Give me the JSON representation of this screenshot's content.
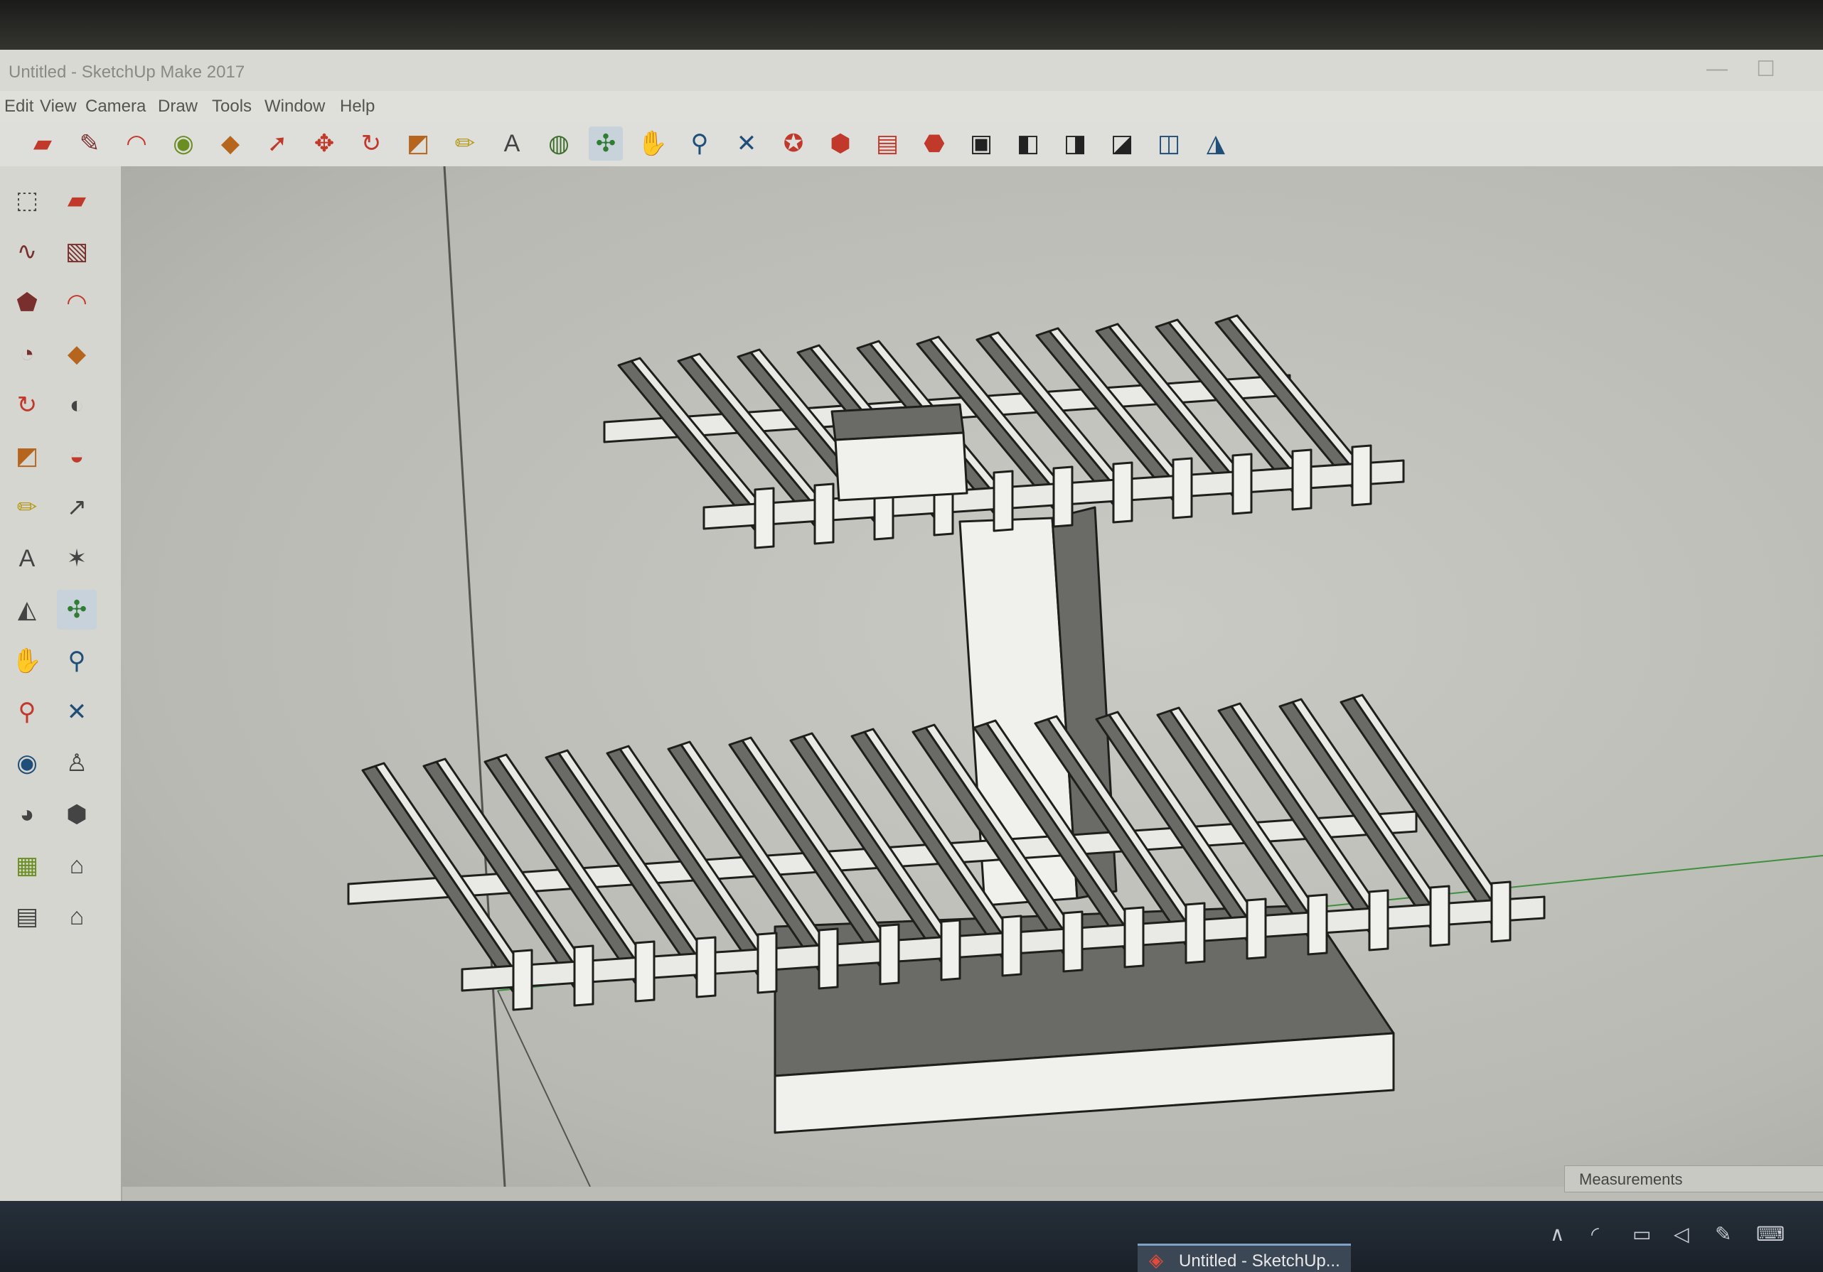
{
  "window": {
    "title": "Untitled - SketchUp Make 2017",
    "controls": {
      "minimize": "—",
      "maximize": "☐"
    }
  },
  "menu": [
    {
      "label": "Edit"
    },
    {
      "label": "View"
    },
    {
      "label": "Camera"
    },
    {
      "label": "Draw"
    },
    {
      "label": "Tools"
    },
    {
      "label": "Window"
    },
    {
      "label": "Help"
    }
  ],
  "toolbar": [
    {
      "icon": "eraser-icon",
      "glyph": "▰",
      "color": "#c0392b"
    },
    {
      "icon": "pencil-icon",
      "glyph": "✎",
      "color": "#7a2f2f"
    },
    {
      "icon": "arc-icon",
      "glyph": "◠",
      "color": "#c0392b"
    },
    {
      "icon": "circle-icon",
      "glyph": "◉",
      "color": "#6b8e23"
    },
    {
      "icon": "push-pull-icon",
      "glyph": "◆",
      "color": "#b5651d"
    },
    {
      "icon": "follow-me-icon",
      "glyph": "➚",
      "color": "#c0392b"
    },
    {
      "icon": "move-icon",
      "glyph": "✥",
      "color": "#c0392b"
    },
    {
      "icon": "rotate-icon",
      "glyph": "↻",
      "color": "#c0392b"
    },
    {
      "icon": "scale-icon",
      "glyph": "◩",
      "color": "#b5651d"
    },
    {
      "icon": "tape-measure-icon",
      "glyph": "✏",
      "color": "#b59b1d"
    },
    {
      "icon": "text-icon",
      "glyph": "A",
      "color": "#444444"
    },
    {
      "icon": "paint-bucket-icon",
      "glyph": "◍",
      "color": "#3b6e2a"
    },
    {
      "icon": "orbit-icon",
      "glyph": "✣",
      "color": "#2e7d32",
      "active": true
    },
    {
      "icon": "pan-icon",
      "glyph": "✋",
      "color": "#b59b1d"
    },
    {
      "icon": "zoom-icon",
      "glyph": "⚲",
      "color": "#1f4e79"
    },
    {
      "icon": "zoom-extents-icon",
      "glyph": "✕",
      "color": "#1f4e79"
    },
    {
      "icon": "warehouse-icon",
      "glyph": "✪",
      "color": "#c0392b"
    },
    {
      "icon": "share-model-icon",
      "glyph": "⬢",
      "color": "#c0392b"
    },
    {
      "icon": "extension-warehouse-icon",
      "glyph": "▤",
      "color": "#c0392b"
    },
    {
      "icon": "layout-icon",
      "glyph": "⬣",
      "color": "#c0392b"
    },
    {
      "icon": "iso-view-icon",
      "glyph": "▣",
      "color": "#222222"
    },
    {
      "icon": "top-view-icon",
      "glyph": "◧",
      "color": "#222222"
    },
    {
      "icon": "front-view-icon",
      "glyph": "◨",
      "color": "#222222"
    },
    {
      "icon": "right-view-icon",
      "glyph": "◪",
      "color": "#222222"
    },
    {
      "icon": "back-view-icon",
      "glyph": "◫",
      "color": "#1f4e79"
    },
    {
      "icon": "left-view-icon",
      "glyph": "◮",
      "color": "#1f4e79"
    }
  ],
  "sidebar": [
    {
      "icon": "select-icon",
      "glyph": "⬚",
      "color": "#444444"
    },
    {
      "icon": "make-component-icon",
      "glyph": "▰",
      "color": "#c0392b"
    },
    {
      "icon": "freehand-icon",
      "glyph": "∿",
      "color": "#7a2f2f"
    },
    {
      "icon": "rectangle-icon",
      "glyph": "▧",
      "color": "#7a2f2f"
    },
    {
      "icon": "polygon-icon",
      "glyph": "⬟",
      "color": "#7a2f2f"
    },
    {
      "icon": "arc-icon",
      "glyph": "◠",
      "color": "#c0392b"
    },
    {
      "icon": "pie-icon",
      "glyph": "◔",
      "color": "#7a2f2f"
    },
    {
      "icon": "offset-icon",
      "glyph": "◆",
      "color": "#b5651d"
    },
    {
      "icon": "rotate-icon",
      "glyph": "↻",
      "color": "#c0392b"
    },
    {
      "icon": "follow-me-icon",
      "glyph": "◐",
      "color": "#444444"
    },
    {
      "icon": "scale-icon",
      "glyph": "◩",
      "color": "#b5651d"
    },
    {
      "icon": "protractor-icon",
      "glyph": "◒",
      "color": "#c0392b"
    },
    {
      "icon": "tape-measure-icon",
      "glyph": "✏",
      "color": "#b59b1d"
    },
    {
      "icon": "dimension-icon",
      "glyph": "↗",
      "color": "#444444"
    },
    {
      "icon": "text-icon",
      "glyph": "A",
      "color": "#444444"
    },
    {
      "icon": "axes-icon",
      "glyph": "✶",
      "color": "#444444"
    },
    {
      "icon": "section-plane-icon",
      "glyph": "◭",
      "color": "#444444"
    },
    {
      "icon": "orbit-icon",
      "glyph": "✣",
      "color": "#2e7d32",
      "active": true
    },
    {
      "icon": "pan-icon",
      "glyph": "✋",
      "color": "#b59b1d"
    },
    {
      "icon": "zoom-icon",
      "glyph": "⚲",
      "color": "#1f4e79"
    },
    {
      "icon": "zoom-window-icon",
      "glyph": "⚲",
      "color": "#c0392b"
    },
    {
      "icon": "zoom-extents-icon",
      "glyph": "✕",
      "color": "#1f4e79"
    },
    {
      "icon": "previous-view-icon",
      "glyph": "◉",
      "color": "#1f4e79"
    },
    {
      "icon": "position-camera-icon",
      "glyph": "♙",
      "color": "#444444"
    },
    {
      "icon": "look-around-icon",
      "glyph": "◕",
      "color": "#444444"
    },
    {
      "icon": "walk-icon",
      "glyph": "⬢",
      "color": "#444444"
    },
    {
      "icon": "sandbox-icon",
      "glyph": "▦",
      "color": "#6b8e23"
    },
    {
      "icon": "warehouse-icon",
      "glyph": "⌂",
      "color": "#444444"
    },
    {
      "icon": "layout-icon",
      "glyph": "▤",
      "color": "#444444"
    },
    {
      "icon": "home-icon",
      "glyph": "⌂",
      "color": "#444444"
    }
  ],
  "measurements": {
    "label": "Measurements"
  },
  "taskbar": {
    "app_label": "Untitled - SketchUp...",
    "tray": [
      {
        "icon": "chevron-up-icon",
        "glyph": "∧"
      },
      {
        "icon": "wifi-icon",
        "glyph": "◜"
      },
      {
        "icon": "battery-icon",
        "glyph": "▭"
      },
      {
        "icon": "volume-icon",
        "glyph": "◁"
      },
      {
        "icon": "pen-icon",
        "glyph": "✎"
      },
      {
        "icon": "keyboard-icon",
        "glyph": "⌨"
      }
    ]
  },
  "colors": {
    "viewport": "#c2c2bc",
    "model_top": "#e9e9e5",
    "model_side": "#6a6a66",
    "model_face": "#f0f0ec",
    "axis_green": "#3f8f3f",
    "axis_dark": "#555550"
  }
}
